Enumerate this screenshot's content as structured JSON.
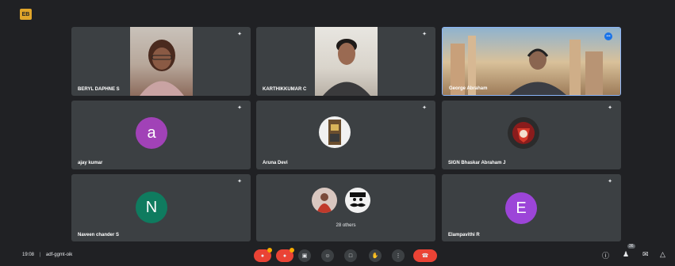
{
  "meeting": {
    "time": "19:08",
    "separator": "|",
    "code": "adf-ggmt-oik",
    "self_badge": "EB",
    "others_label": "28 others"
  },
  "participants": [
    {
      "name": "BERYL DAPHNE S"
    },
    {
      "name": "KARTHIKKUMAR C"
    },
    {
      "name": "George Abraham"
    },
    {
      "name": "ajay kumar",
      "initial": "a",
      "avatar_color": "#a142b7"
    },
    {
      "name": "Aruna Devi"
    },
    {
      "name": "SIGN Bhaskar Abraham J"
    },
    {
      "name": "Naveen chander S",
      "initial": "N",
      "avatar_color": "#0f7b5f"
    },
    {
      "name": "Elampavithi R",
      "initial": "E",
      "avatar_color": "#9c45d8"
    }
  ],
  "controls": [
    {
      "icon": "mic-off-icon"
    },
    {
      "icon": "camera-off-icon"
    },
    {
      "icon": "captions-icon"
    },
    {
      "icon": "emoji-icon"
    },
    {
      "icon": "present-icon"
    },
    {
      "icon": "raise-hand-icon"
    },
    {
      "icon": "more-options-icon"
    },
    {
      "icon": "end-call-icon"
    }
  ],
  "right_controls": {
    "participant_count": "36"
  },
  "colors": {
    "background": "#202124",
    "tile": "#3c4043",
    "end_call": "#ea4335",
    "active_border": "#8ab4f8"
  }
}
